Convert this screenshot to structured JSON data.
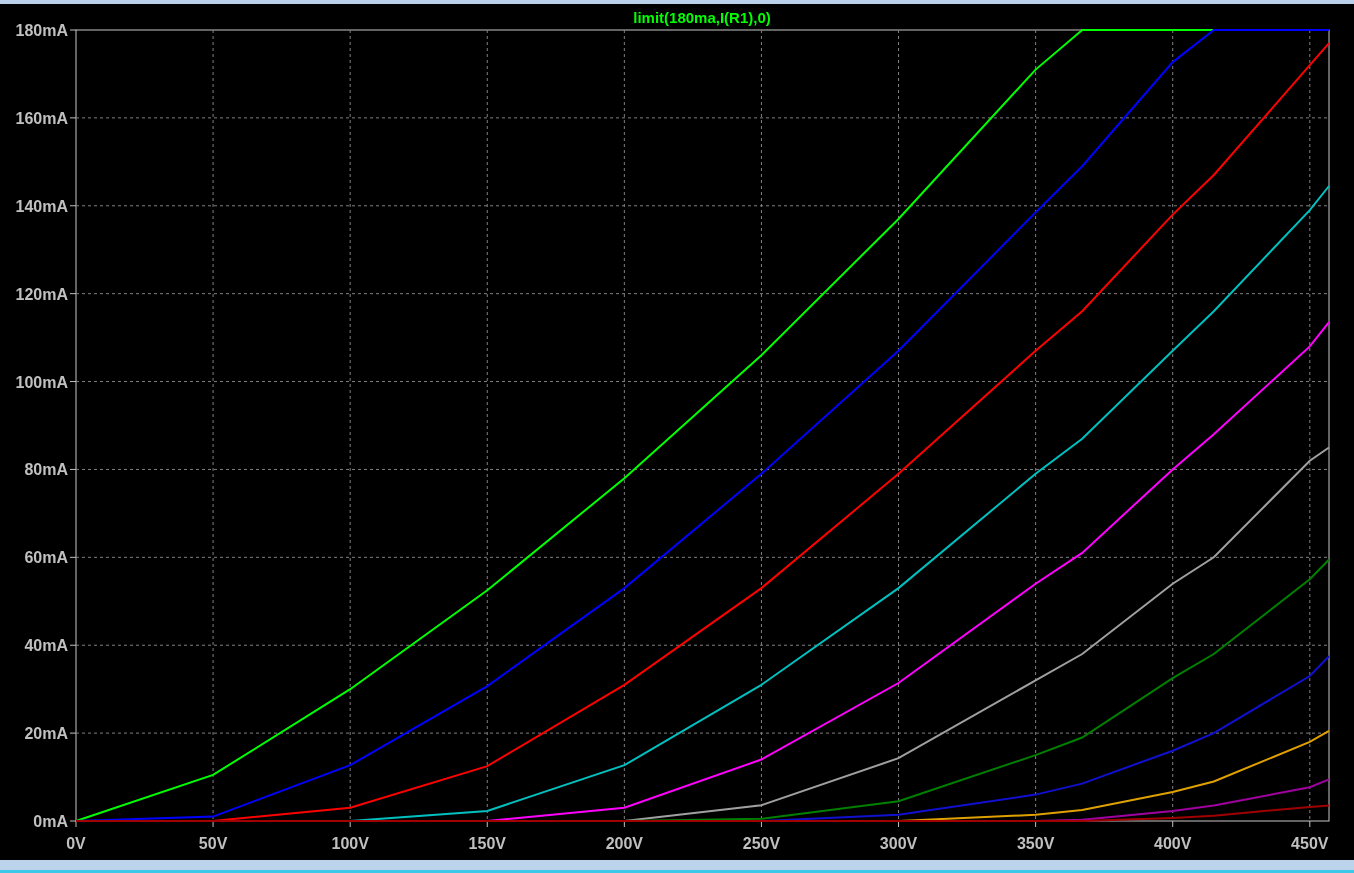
{
  "plot": {
    "chart_data": {
      "type": "line",
      "title": "limit(180ma,I(R1),0)",
      "grid": true,
      "x": [
        0,
        50,
        100,
        150,
        200,
        250,
        300,
        350,
        367,
        400,
        415,
        450,
        457
      ],
      "series": [
        {
          "color": "#00ff00",
          "values": [
            0,
            10.5,
            30,
            52.5,
            78,
            106,
            137,
            171,
            180,
            180,
            180,
            null,
            null
          ]
        },
        {
          "color": "#0000ff",
          "values": [
            0,
            1,
            12.7,
            30.7,
            53,
            79,
            107,
            138.5,
            149,
            172.7,
            180,
            180,
            180
          ]
        },
        {
          "color": "#ff0000",
          "values": [
            null,
            0,
            3,
            12.5,
            31,
            53,
            79,
            107,
            116,
            138,
            147,
            172,
            177
          ]
        },
        {
          "color": "#00c0c0",
          "values": [
            null,
            null,
            0,
            2.3,
            12.7,
            31,
            53,
            79,
            87,
            107,
            116,
            139,
            144.5
          ]
        },
        {
          "color": "#ff00ff",
          "values": [
            null,
            null,
            null,
            0,
            3,
            14,
            31.4,
            54,
            61,
            80,
            88,
            108,
            113.5
          ]
        },
        {
          "color": "#a0a0a0",
          "values": [
            null,
            null,
            null,
            null,
            0,
            3.6,
            14.3,
            32,
            38,
            54,
            60,
            82,
            85
          ]
        },
        {
          "color": "#008000",
          "values": [
            null,
            null,
            null,
            null,
            0,
            0.5,
            4.5,
            15,
            19,
            32.5,
            38,
            55,
            59.5
          ]
        },
        {
          "color": "#1010d0",
          "values": [
            null,
            null,
            null,
            null,
            null,
            0,
            1.4,
            6,
            8.5,
            16,
            20,
            33,
            37.5
          ]
        },
        {
          "color": "#e0a000",
          "values": [
            null,
            null,
            null,
            null,
            null,
            null,
            0,
            1.4,
            2.5,
            6.6,
            9,
            18,
            20.5
          ]
        },
        {
          "color": "#a000a0",
          "values": [
            null,
            null,
            null,
            null,
            null,
            null,
            null,
            0,
            0.3,
            2.3,
            3.5,
            7.7,
            9.5
          ]
        },
        {
          "color": "#a00000",
          "values": [
            0,
            0,
            0,
            0,
            0,
            0,
            0,
            0,
            0,
            0.7,
            1.2,
            3.2,
            3.5
          ]
        }
      ],
      "xlim": [
        0,
        457
      ],
      "ylim": [
        0,
        180
      ],
      "xticks": [
        {
          "value": 0,
          "label": "0V"
        },
        {
          "value": 50,
          "label": "50V"
        },
        {
          "value": 100,
          "label": "100V"
        },
        {
          "value": 150,
          "label": "150V"
        },
        {
          "value": 200,
          "label": "200V"
        },
        {
          "value": 250,
          "label": "250V"
        },
        {
          "value": 300,
          "label": "300V"
        },
        {
          "value": 350,
          "label": "350V"
        },
        {
          "value": 400,
          "label": "400V"
        },
        {
          "value": 450,
          "label": "450V"
        }
      ],
      "yticks": [
        {
          "value": 0,
          "label": "0mA"
        },
        {
          "value": 20,
          "label": "20mA"
        },
        {
          "value": 40,
          "label": "40mA"
        },
        {
          "value": 60,
          "label": "60mA"
        },
        {
          "value": 80,
          "label": "80mA"
        },
        {
          "value": 100,
          "label": "100mA"
        },
        {
          "value": 120,
          "label": "120mA"
        },
        {
          "value": 140,
          "label": "140mA"
        },
        {
          "value": 160,
          "label": "160mA"
        },
        {
          "value": 180,
          "label": "180mA"
        }
      ]
    }
  }
}
